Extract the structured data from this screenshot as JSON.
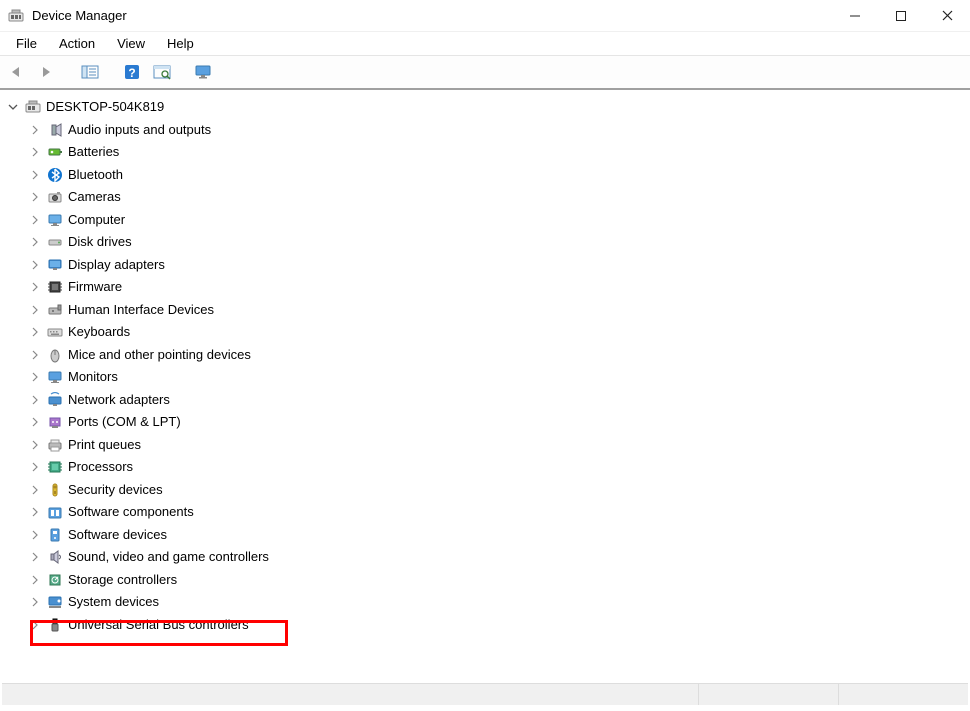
{
  "window": {
    "title": "Device Manager"
  },
  "menu": {
    "items": [
      "File",
      "Action",
      "View",
      "Help"
    ]
  },
  "toolbar": {
    "buttons": [
      "back",
      "forward",
      "show-hide-tree",
      "help",
      "scan-hardware",
      "monitor"
    ]
  },
  "tree": {
    "root": {
      "label": "DESKTOP-504K819",
      "expanded": true
    },
    "categories": [
      {
        "label": "Audio inputs and outputs",
        "icon": "speaker"
      },
      {
        "label": "Batteries",
        "icon": "battery"
      },
      {
        "label": "Bluetooth",
        "icon": "bluetooth"
      },
      {
        "label": "Cameras",
        "icon": "camera"
      },
      {
        "label": "Computer",
        "icon": "computer"
      },
      {
        "label": "Disk drives",
        "icon": "disk"
      },
      {
        "label": "Display adapters",
        "icon": "display"
      },
      {
        "label": "Firmware",
        "icon": "firmware"
      },
      {
        "label": "Human Interface Devices",
        "icon": "hid"
      },
      {
        "label": "Keyboards",
        "icon": "keyboard"
      },
      {
        "label": "Mice and other pointing devices",
        "icon": "mouse"
      },
      {
        "label": "Monitors",
        "icon": "monitor"
      },
      {
        "label": "Network adapters",
        "icon": "network"
      },
      {
        "label": "Ports (COM & LPT)",
        "icon": "ports"
      },
      {
        "label": "Print queues",
        "icon": "printer"
      },
      {
        "label": "Processors",
        "icon": "cpu"
      },
      {
        "label": "Security devices",
        "icon": "security"
      },
      {
        "label": "Software components",
        "icon": "swcomp"
      },
      {
        "label": "Software devices",
        "icon": "swdev"
      },
      {
        "label": "Sound, video and game controllers",
        "icon": "sound"
      },
      {
        "label": "Storage controllers",
        "icon": "storage"
      },
      {
        "label": "System devices",
        "icon": "system"
      },
      {
        "label": "Universal Serial Bus controllers",
        "icon": "usb",
        "highlighted": true
      }
    ]
  }
}
